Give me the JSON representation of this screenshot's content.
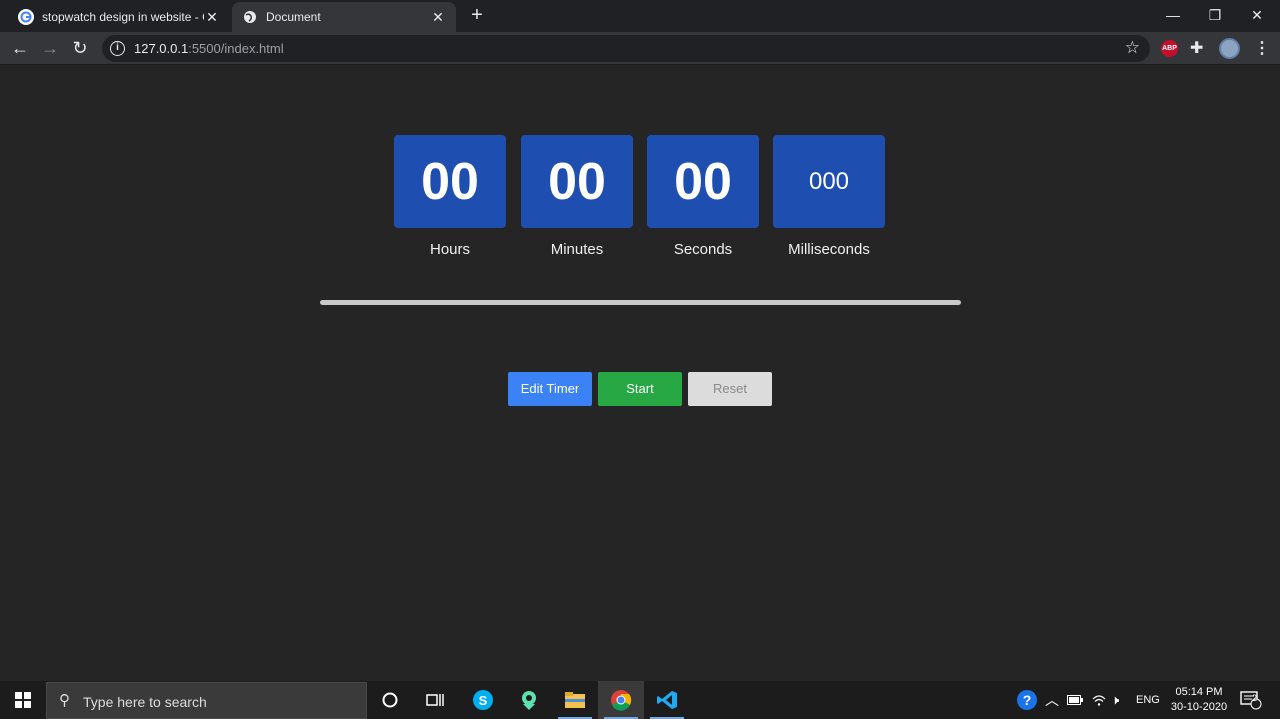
{
  "browser": {
    "tabs": [
      {
        "title": "stopwatch design in website - Go",
        "active": false,
        "icon": "google-icon"
      },
      {
        "title": "Document",
        "active": true,
        "icon": "globe-icon"
      }
    ],
    "url_host": "127.0.0.1",
    "url_rest": ":5500/index.html",
    "extensions": {
      "abp_label": "ABP"
    }
  },
  "stopwatch": {
    "units": [
      {
        "value": "00",
        "label": "Hours"
      },
      {
        "value": "00",
        "label": "Minutes"
      },
      {
        "value": "00",
        "label": "Seconds"
      },
      {
        "value": "000",
        "label": "Milliseconds"
      }
    ],
    "progress_fraction": 0,
    "buttons": {
      "edit": "Edit Timer",
      "start": "Start",
      "reset": "Reset"
    }
  },
  "taskbar": {
    "search_placeholder": "Type here to search",
    "language": "ENG",
    "time": "05:14 PM",
    "date": "30-10-2020",
    "notification_count": "2"
  },
  "colors": {
    "box": "#1e4fb0",
    "edit": "#3b82f6",
    "start": "#27a844",
    "reset": "#dcdcdc"
  }
}
